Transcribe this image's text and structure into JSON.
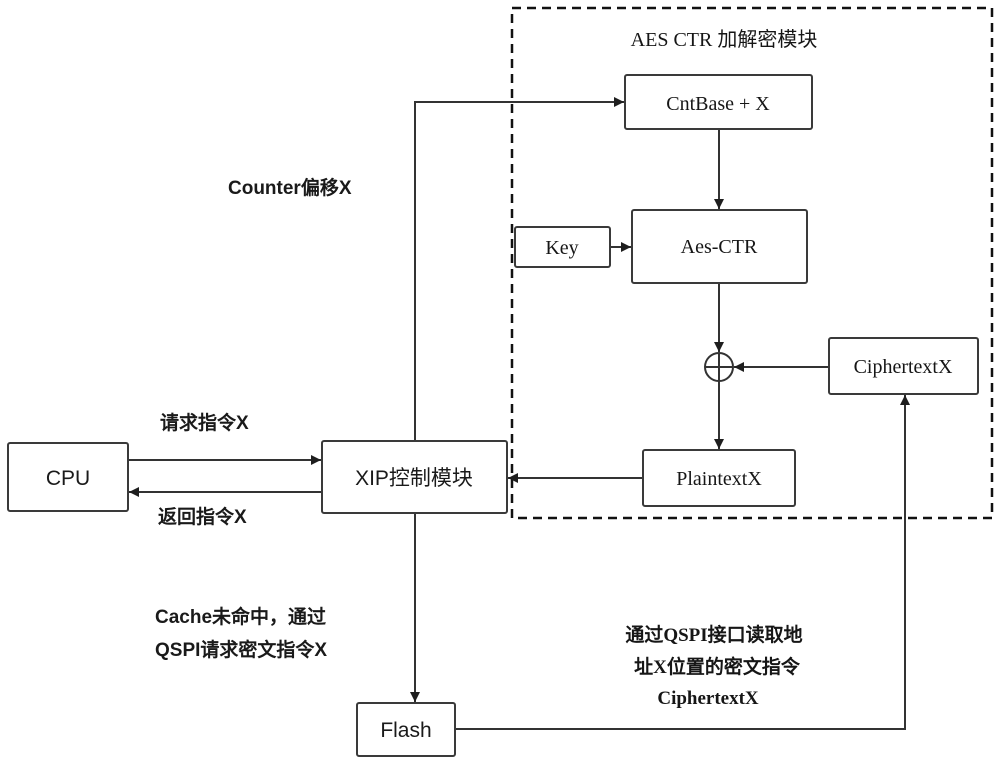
{
  "diagram": {
    "module_title": "AES CTR 加解密模块",
    "nodes": {
      "cpu": "CPU",
      "xip": "XIP控制模块",
      "flash": "Flash",
      "cntbase": "CntBase + X",
      "key": "Key",
      "aes": "Aes-CTR",
      "ciphertext": "CiphertextX",
      "plaintext": "PlaintextX"
    },
    "operators": {
      "xor": "xor-circle-plus"
    },
    "edge_labels": {
      "counter_offset": "Counter偏移X",
      "request": "请求指令X",
      "return": "返回指令X",
      "cache_miss": [
        "Cache未命中，通过",
        "QSPI请求密文指令X"
      ],
      "qspi_read": [
        "通过QSPI接口读取地",
        "址X位置的密文指令",
        "CiphertextX"
      ]
    }
  }
}
